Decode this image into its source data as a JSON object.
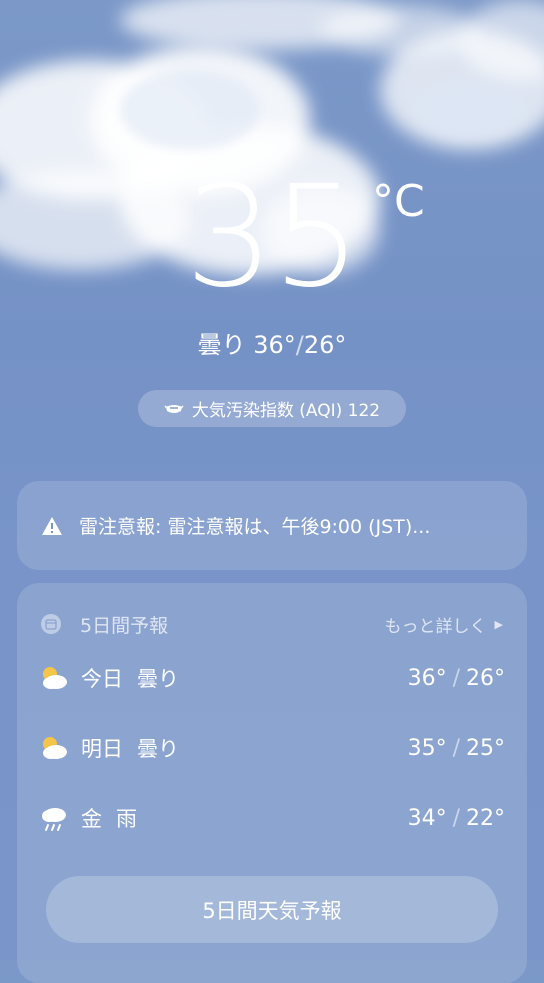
{
  "current": {
    "temperature": "35",
    "unit": "°C",
    "condition": "曇り",
    "high": "36°",
    "low": "26°",
    "aqi_text": "大気汚染指数 (AQI) 122"
  },
  "alert": {
    "text": "雷注意報: 雷注意報は、午後9:00 (JST)..."
  },
  "forecast": {
    "title": "5日間予報",
    "more_label": "もっと詳しく",
    "days": [
      {
        "day": "今日",
        "condition": "曇り",
        "high": "36°",
        "low": "26°",
        "icon": "partly-cloudy-icon"
      },
      {
        "day": "明日",
        "condition": "曇り",
        "high": "35°",
        "low": "25°",
        "icon": "partly-cloudy-icon"
      },
      {
        "day": "金",
        "condition": "雨",
        "high": "34°",
        "low": "22°",
        "icon": "rain-icon"
      }
    ],
    "button_label": "5日間天気予報"
  }
}
